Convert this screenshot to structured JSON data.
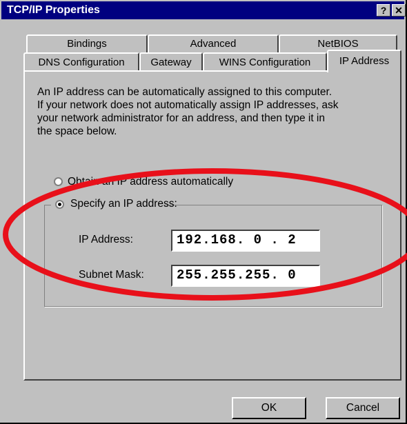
{
  "window": {
    "title": "TCP/IP Properties",
    "help_label": "?",
    "close_label": "✕"
  },
  "tabs": {
    "row_back": [
      {
        "label": "Bindings"
      },
      {
        "label": "Advanced"
      },
      {
        "label": "NetBIOS"
      }
    ],
    "row_front": [
      {
        "label": "DNS Configuration"
      },
      {
        "label": "Gateway"
      },
      {
        "label": "WINS Configuration"
      },
      {
        "label": "IP Address"
      }
    ],
    "active": "IP Address"
  },
  "ip_tab": {
    "description_lines": [
      "An IP address can be automatically assigned to this computer.",
      "If your network does not automatically assign IP addresses, ask",
      "your network administrator for an address, and then type it in",
      "the space below."
    ],
    "obtain_label": "Obtain an IP address automatically",
    "specify_label": "Specify an IP address:",
    "selected_option": "specify",
    "ip_label": "IP Address:",
    "ip_value": "192.168. 0 . 2",
    "mask_label": "Subnet Mask:",
    "mask_value": "255.255.255. 0"
  },
  "buttons": {
    "ok": "OK",
    "cancel": "Cancel"
  },
  "colors": {
    "face": "#c0c0c0",
    "title_bar": "#000080",
    "annotation_ellipse": "#e8101a"
  }
}
